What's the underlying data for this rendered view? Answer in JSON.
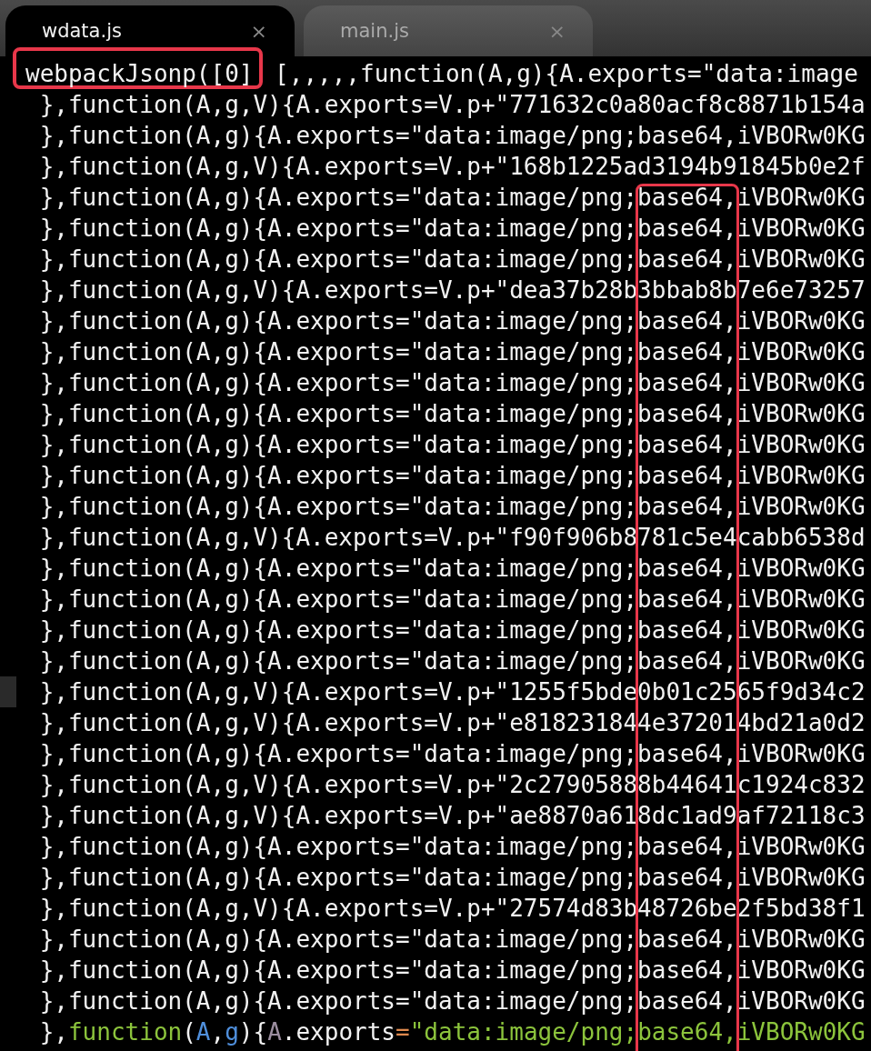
{
  "tabs": [
    {
      "label": "wdata.js",
      "close": "×",
      "selected": true
    },
    {
      "label": "main.js",
      "close": "×",
      "selected": false
    }
  ],
  "lines": [
    {
      "kind": "boxed",
      "current": false,
      "boxed_text": "webpackJsonp([0]",
      "text": "[,,,,,function(A,g){A.exports=\"data:image"
    },
    {
      "kind": "plain",
      "current": false,
      "text": " },function(A,g,V){A.exports=V.p+\"771632c0a80acf8c8871b154a"
    },
    {
      "kind": "plain",
      "current": false,
      "text": " },function(A,g){A.exports=\"data:image/png;base64,iVBORw0KG"
    },
    {
      "kind": "plain",
      "current": false,
      "text": " },function(A,g,V){A.exports=V.p+\"168b1225ad3194b91845b0e2f"
    },
    {
      "kind": "plain",
      "current": false,
      "text": " },function(A,g){A.exports=\"data:image/png;base64,iVBORw0KG"
    },
    {
      "kind": "plain",
      "current": false,
      "text": " },function(A,g){A.exports=\"data:image/png;base64,iVBORw0KG"
    },
    {
      "kind": "plain",
      "current": false,
      "text": " },function(A,g){A.exports=\"data:image/png;base64,iVBORw0KG"
    },
    {
      "kind": "plain",
      "current": false,
      "text": " },function(A,g,V){A.exports=V.p+\"dea37b28b3bbab8b7e6e73257"
    },
    {
      "kind": "plain",
      "current": false,
      "text": " },function(A,g){A.exports=\"data:image/png;base64,iVBORw0KG"
    },
    {
      "kind": "plain",
      "current": false,
      "text": " },function(A,g){A.exports=\"data:image/png;base64,iVBORw0KG"
    },
    {
      "kind": "plain",
      "current": false,
      "text": " },function(A,g){A.exports=\"data:image/png;base64,iVBORw0KG"
    },
    {
      "kind": "plain",
      "current": false,
      "text": " },function(A,g){A.exports=\"data:image/png;base64,iVBORw0KG"
    },
    {
      "kind": "plain",
      "current": false,
      "text": " },function(A,g){A.exports=\"data:image/png;base64,iVBORw0KG"
    },
    {
      "kind": "plain",
      "current": false,
      "text": " },function(A,g){A.exports=\"data:image/png;base64,iVBORw0KG"
    },
    {
      "kind": "plain",
      "current": false,
      "text": " },function(A,g){A.exports=\"data:image/png;base64,iVBORw0KG"
    },
    {
      "kind": "plain",
      "current": false,
      "text": " },function(A,g,V){A.exports=V.p+\"f90f906b8781c5e4cabb6538d"
    },
    {
      "kind": "plain",
      "current": false,
      "text": " },function(A,g){A.exports=\"data:image/png;base64,iVBORw0KG"
    },
    {
      "kind": "plain",
      "current": false,
      "text": " },function(A,g){A.exports=\"data:image/png;base64,iVBORw0KG"
    },
    {
      "kind": "plain",
      "current": false,
      "text": " },function(A,g){A.exports=\"data:image/png;base64,iVBORw0KG"
    },
    {
      "kind": "plain",
      "current": false,
      "text": " },function(A,g){A.exports=\"data:image/png;base64,iVBORw0KG"
    },
    {
      "kind": "plain",
      "current": true,
      "text": " },function(A,g,V){A.exports=V.p+\"1255f5bde0b01c2565f9d34c2"
    },
    {
      "kind": "plain",
      "current": false,
      "text": " },function(A,g,V){A.exports=V.p+\"e818231844e372014bd21a0d2"
    },
    {
      "kind": "plain",
      "current": false,
      "text": " },function(A,g){A.exports=\"data:image/png;base64,iVBORw0KG"
    },
    {
      "kind": "plain",
      "current": false,
      "text": " },function(A,g,V){A.exports=V.p+\"2c27905888b44641c1924c832"
    },
    {
      "kind": "plain",
      "current": false,
      "text": " },function(A,g,V){A.exports=V.p+\"ae8870a618dc1ad9af72118c3"
    },
    {
      "kind": "plain",
      "current": false,
      "text": " },function(A,g){A.exports=\"data:image/png;base64,iVBORw0KG"
    },
    {
      "kind": "plain",
      "current": false,
      "text": " },function(A,g){A.exports=\"data:image/png;base64,iVBORw0KG"
    },
    {
      "kind": "plain",
      "current": false,
      "text": " },function(A,g,V){A.exports=V.p+\"27574d83b48726be2f5bd38f1"
    },
    {
      "kind": "plain",
      "current": false,
      "text": " },function(A,g){A.exports=\"data:image/png;base64,iVBORw0KG"
    },
    {
      "kind": "plain",
      "current": false,
      "text": " },function(A,g){A.exports=\"data:image/png;base64,iVBORw0KG"
    },
    {
      "kind": "plain",
      "current": false,
      "text": " },function(A,g){A.exports=\"data:image/png;base64,iVBORw0KG"
    },
    {
      "kind": "highlighted",
      "current": false,
      "tokens": [
        {
          "text": " },",
          "color": "#f2f2f2"
        },
        {
          "text": "function",
          "color": "#8cc43c"
        },
        {
          "text": "(",
          "color": "#f2f2f2"
        },
        {
          "text": "A",
          "color": "#4f8fdc"
        },
        {
          "text": ",",
          "color": "#f2f2f2"
        },
        {
          "text": "g",
          "color": "#4f8fdc"
        },
        {
          "text": "){",
          "color": "#f2f2f2"
        },
        {
          "text": "A",
          "color": "#9c8ea0"
        },
        {
          "text": ".exports",
          "color": "#f2f2f2"
        },
        {
          "text": "=",
          "color": "#e08a4e"
        },
        {
          "text": "\"data:image/png;base64,iVBORw0KG",
          "color": "#8cc43c"
        }
      ]
    }
  ]
}
